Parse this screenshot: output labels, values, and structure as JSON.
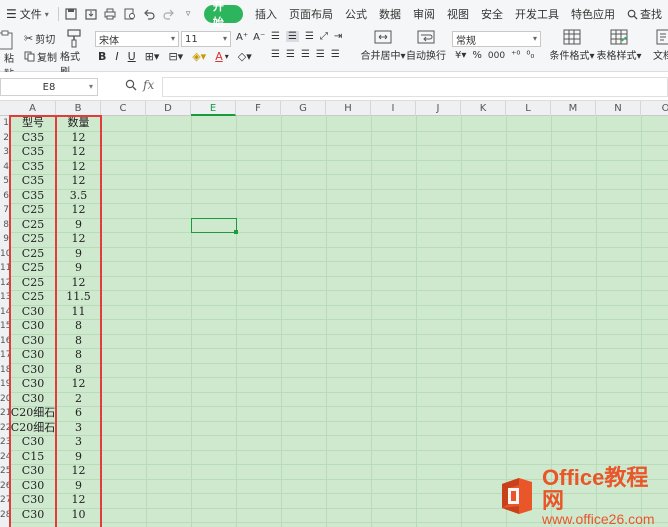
{
  "menubar": {
    "file_label": "文件",
    "tabs": [
      "开始",
      "插入",
      "页面布局",
      "公式",
      "数据",
      "审阅",
      "视图",
      "安全",
      "开发工具",
      "特色应用"
    ],
    "search_label": "查找"
  },
  "ribbon": {
    "cut_label": "剪切",
    "copy_label": "复制",
    "paste_label": "粘贴",
    "format_painter_label": "格式刷",
    "font_name": "宋体",
    "font_size": "11",
    "bold": "B",
    "italic": "I",
    "underline": "U",
    "merge_center_label": "合并居中",
    "wrap_text_label": "自动换行",
    "number_format": "常规",
    "percent_symbol": "%",
    "thousand_symbol": "000",
    "conditional_format_label": "条件格式",
    "table_style_label": "表格样式",
    "doc_helper_label": "文档"
  },
  "formula_bar": {
    "name_box": "E8",
    "fx_label": "fx",
    "formula": ""
  },
  "sheet": {
    "columns": [
      "A",
      "B",
      "C",
      "D",
      "E",
      "F",
      "G",
      "H",
      "I",
      "J",
      "K",
      "L",
      "M",
      "N",
      "O"
    ],
    "row_numbers": [
      "1",
      "2",
      "3",
      "4",
      "5",
      "6",
      "7",
      "8",
      "9",
      "10",
      "11",
      "12",
      "13",
      "14",
      "15",
      "16",
      "17",
      "18",
      "19",
      "20",
      "21",
      "22",
      "23",
      "24",
      "25",
      "26",
      "27",
      "28"
    ],
    "header_a": "型号",
    "header_b": "数量",
    "rows": [
      [
        "C35",
        "12"
      ],
      [
        "C35",
        "12"
      ],
      [
        "C35",
        "12"
      ],
      [
        "C35",
        "12"
      ],
      [
        "C35",
        "3.5"
      ],
      [
        "C25",
        "12"
      ],
      [
        "C25",
        "9"
      ],
      [
        "C25",
        "12"
      ],
      [
        "C25",
        "9"
      ],
      [
        "C25",
        "9"
      ],
      [
        "C25",
        "12"
      ],
      [
        "C25",
        "11.5"
      ],
      [
        "C30",
        "11"
      ],
      [
        "C30",
        "8"
      ],
      [
        "C30",
        "8"
      ],
      [
        "C30",
        "8"
      ],
      [
        "C30",
        "8"
      ],
      [
        "C30",
        "12"
      ],
      [
        "C30",
        "2"
      ],
      [
        "C20细石",
        "6"
      ],
      [
        "C20细石",
        "3"
      ],
      [
        "C30",
        "3"
      ],
      [
        "C15",
        "9"
      ],
      [
        "C30",
        "12"
      ],
      [
        "C30",
        "9"
      ],
      [
        "C30",
        "12"
      ],
      [
        "C30",
        "10"
      ]
    ],
    "selected_cell": "E8"
  },
  "watermark": {
    "title": "Office教程网",
    "url": "www.office26.com"
  },
  "colors": {
    "accent": "#2db55d",
    "sheet_bg": "#cfe9cf",
    "selection": "#1a9c3e",
    "highlight": "#e23b3b",
    "brand": "#e8562a"
  }
}
